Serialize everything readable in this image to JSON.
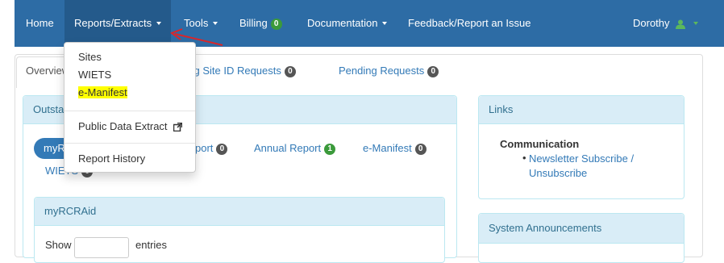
{
  "navbar": {
    "home": "Home",
    "reports_extracts": "Reports/Extracts",
    "tools": "Tools",
    "billing": "Billing",
    "billing_count": "0",
    "documentation": "Documentation",
    "feedback": "Feedback/Report an Issue",
    "user": "Dorothy"
  },
  "tabs": [
    {
      "label": "Overview"
    },
    {
      "label": "Pending Site ID Requests",
      "count": "0"
    },
    {
      "label": "Pending Requests",
      "count": "0"
    }
  ],
  "dropdown": {
    "items": [
      "Sites",
      "WIETS",
      "e-Manifest",
      "Public Data Extract",
      "Report History"
    ]
  },
  "outstanding_panel": {
    "title": "Outstanding",
    "pill": "myR",
    "items": [
      {
        "label": "port",
        "count": "0"
      },
      {
        "label": "Annual Report",
        "count": "1"
      },
      {
        "label": "e-Manifest",
        "count": "0"
      }
    ],
    "wiets_label": "WIETS",
    "wiets_count": "0",
    "sub_panel_title": "myRCRAid",
    "show_label": "Show",
    "entries_label": "entries"
  },
  "links_panel": {
    "title": "Links",
    "heading": "Communication",
    "item": "Newsletter Subscribe / Unsubscribe"
  },
  "announcements_panel": {
    "title": "System Announcements"
  },
  "colors": {
    "navbar": "#2d6ca5",
    "highlight": "#ffff00",
    "badge_green": "#3b9a3b",
    "badge_gray": "#555555",
    "arrow": "#d9262a"
  }
}
